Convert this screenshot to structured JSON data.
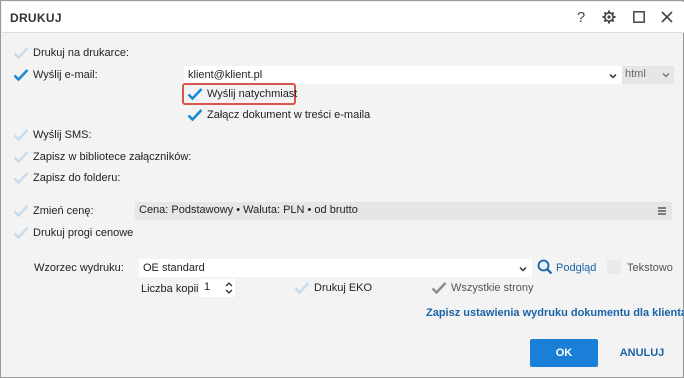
{
  "dialog": {
    "title": "DRUKUJ",
    "help_label": "?"
  },
  "options": {
    "print_on_printer": "Drukuj na drukarce:",
    "send_email": "Wyślij e-mail:",
    "email_value": "klient@klient.pl",
    "email_format": "html",
    "send_immediately": "Wyślij natychmiast",
    "attach_in_body": "Załącz dokument w treści e-maila",
    "send_sms": "Wyślij SMS:",
    "save_attachments": "Zapisz w bibliotece załączników:",
    "save_folder": "Zapisz do folderu:",
    "change_price": "Zmień cenę:",
    "price_value": "Cena: Podstawowy • Waluta: PLN • od brutto",
    "print_price_thresholds": "Drukuj progi cenowe"
  },
  "template": {
    "label": "Wzorzec wydruku:",
    "value": "OE standard",
    "preview_link": "Podgląd",
    "text_option": "Tekstowo"
  },
  "copies": {
    "label": "Liczba kopii:",
    "value": "1",
    "print_eko": "Drukuj EKO",
    "all_pages": "Wszystkie strony"
  },
  "save_settings_link": "Zapisz ustawienia wydruku dokumentu dla klienta",
  "buttons": {
    "ok": "OK",
    "cancel": "ANULUJ"
  },
  "colors": {
    "accent": "#1a7fd6",
    "check_on": "#1a8ad4",
    "check_off": "#c9dcec",
    "highlight_border": "#d9534f"
  }
}
